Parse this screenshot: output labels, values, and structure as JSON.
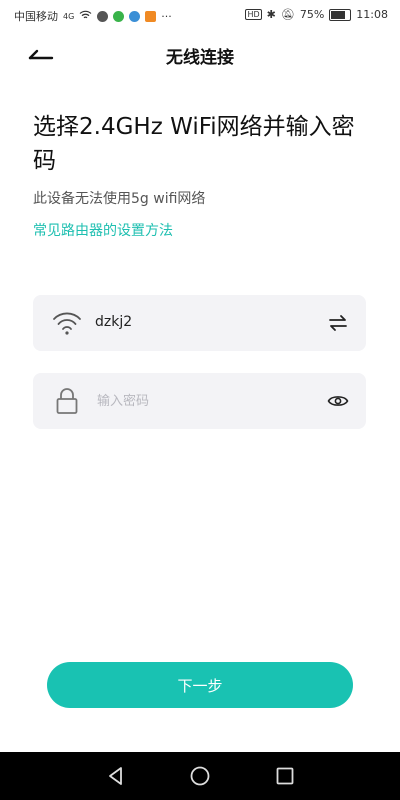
{
  "status_bar": {
    "carrier": "中国移动",
    "signal_label": "4G",
    "battery": "75%",
    "battery_level": 0.75,
    "time": "11:08",
    "icons": [
      "signal-icon",
      "wifi-icon",
      "location-icon",
      "message-icon",
      "app-icon",
      "notification-icon",
      "hd-icon",
      "bluetooth-icon",
      "mute-icon",
      "battery-icon"
    ]
  },
  "header": {
    "title": "无线连接",
    "back_icon": "back-arrow-icon"
  },
  "content": {
    "heading": "选择2.4GHz WiFi网络并输入密码",
    "subtext": "此设备无法使用5g wifi网络",
    "help_link": "常见路由器的设置方法"
  },
  "wifi_field": {
    "icon": "wifi-icon",
    "ssid": "dzkj2",
    "action_icon": "switch-network-icon"
  },
  "password_field": {
    "icon": "lock-icon",
    "placeholder": "输入密码",
    "value": "",
    "action_icon": "eye-icon"
  },
  "next_button": {
    "label": "下一步",
    "color": "#19c2b2"
  },
  "system_nav": {
    "icons": [
      "nav-back-icon",
      "nav-home-icon",
      "nav-recent-icon"
    ]
  }
}
